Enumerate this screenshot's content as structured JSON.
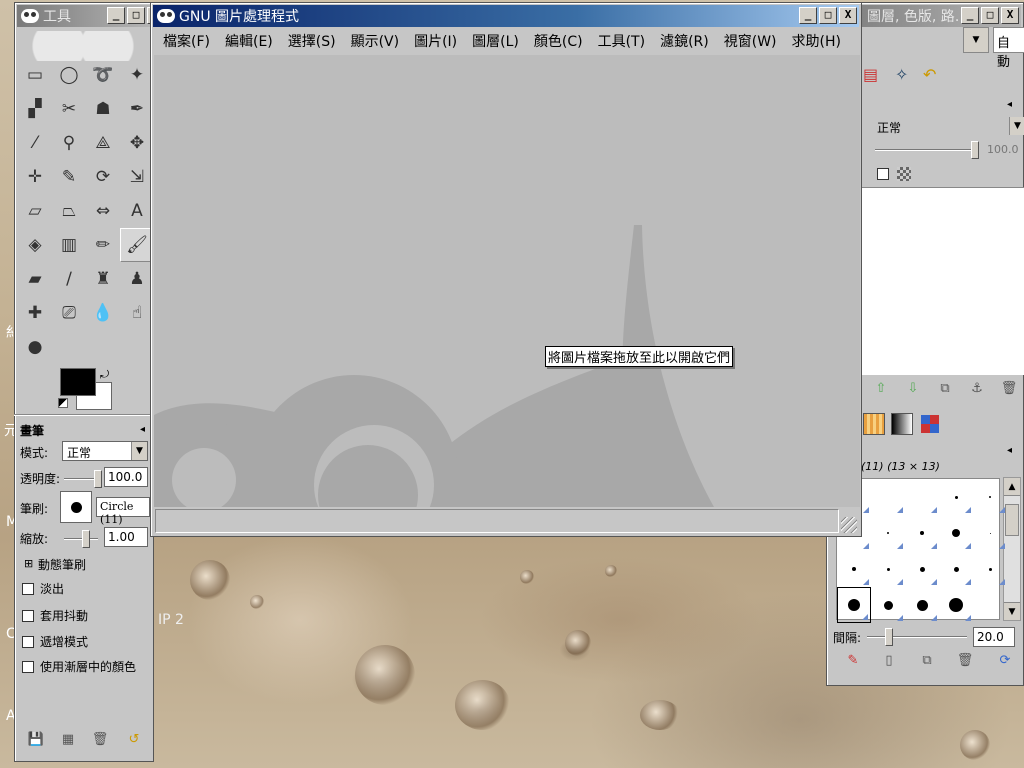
{
  "toolbox": {
    "title": "工具",
    "tools": [
      {
        "name": "rect-select-icon",
        "glyph": "▭"
      },
      {
        "name": "ellipse-select-icon",
        "glyph": "◯"
      },
      {
        "name": "free-select-icon",
        "glyph": "➰"
      },
      {
        "name": "fuzzy-select-icon",
        "glyph": "✦"
      },
      {
        "name": "select-by-color-icon",
        "glyph": "▞"
      },
      {
        "name": "scissors-icon",
        "glyph": "✂"
      },
      {
        "name": "foreground-select-icon",
        "glyph": "☗"
      },
      {
        "name": "paths-icon",
        "glyph": "✒"
      },
      {
        "name": "color-picker-icon",
        "glyph": "⁄"
      },
      {
        "name": "zoom-icon",
        "glyph": "⚲"
      },
      {
        "name": "measure-icon",
        "glyph": "⟁"
      },
      {
        "name": "move-icon",
        "glyph": "✥"
      },
      {
        "name": "align-icon",
        "glyph": "✛"
      },
      {
        "name": "crop-icon",
        "glyph": "✎"
      },
      {
        "name": "rotate-icon",
        "glyph": "⟳"
      },
      {
        "name": "scale-icon",
        "glyph": "⇲"
      },
      {
        "name": "shear-icon",
        "glyph": "▱"
      },
      {
        "name": "perspective-icon",
        "glyph": "⏢"
      },
      {
        "name": "flip-icon",
        "glyph": "⇔"
      },
      {
        "name": "text-icon",
        "glyph": "A"
      },
      {
        "name": "bucket-fill-icon",
        "glyph": "◈"
      },
      {
        "name": "blend-icon",
        "glyph": "▥"
      },
      {
        "name": "pencil-icon",
        "glyph": "✏"
      },
      {
        "name": "paintbrush-icon",
        "glyph": "🖌"
      },
      {
        "name": "eraser-icon",
        "glyph": "▰"
      },
      {
        "name": "airbrush-icon",
        "glyph": "∕"
      },
      {
        "name": "ink-icon",
        "glyph": "♜"
      },
      {
        "name": "clone-icon",
        "glyph": "♟"
      },
      {
        "name": "heal-icon",
        "glyph": "✚"
      },
      {
        "name": "perspective-clone-icon",
        "glyph": "⎚"
      },
      {
        "name": "blur-icon",
        "glyph": "💧"
      },
      {
        "name": "smudge-icon",
        "glyph": "☝"
      },
      {
        "name": "dodge-burn-icon",
        "glyph": "●"
      }
    ],
    "selected_tool_index": 23,
    "options_title": "畫筆",
    "mode_label": "模式:",
    "mode_value": "正常",
    "opacity_label": "透明度:",
    "opacity_value": "100.0",
    "opacity_fraction": 1.0,
    "brush_label": "筆刷:",
    "brush_value": "Circle (11)",
    "scale_label": "縮放:",
    "scale_value": "1.00",
    "dynamics_label": "動態筆刷",
    "checkboxes": [
      "淡出",
      "套用抖動",
      "遞增模式",
      "使用漸層中的顏色"
    ]
  },
  "main_window": {
    "title": "GNU 圖片處理程式",
    "menus": [
      "檔案(F)",
      "編輯(E)",
      "選擇(S)",
      "顯示(V)",
      "圖片(I)",
      "圖層(L)",
      "顏色(C)",
      "工具(T)",
      "濾鏡(R)",
      "視窗(W)",
      "求助(H)"
    ],
    "drop_hint": "將圖片檔案拖放至此以開啟它們"
  },
  "layers_dock": {
    "title_fragment": "圖層, 色版, 路…",
    "auto_label": "自動",
    "mode_value": "正常",
    "opacity_value": "100.0",
    "opacity_fraction": 1.0,
    "brush_info": "(11) (13 × 13)",
    "spacing_label": "間隔:",
    "spacing_value": "20.0",
    "spacing_fraction": 0.2
  },
  "desktop": {
    "fragments": [
      "糹",
      "元",
      "M",
      "C",
      "A",
      "IP 2"
    ]
  },
  "window_controls": {
    "minimize": "_",
    "maximize": "□",
    "close": "X"
  }
}
